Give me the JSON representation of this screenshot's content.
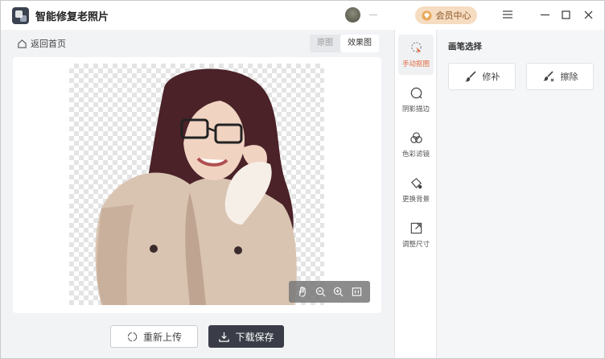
{
  "app": {
    "title": "智能修复老照片"
  },
  "header": {
    "vip_label": "会员中心",
    "user_name": "—"
  },
  "left": {
    "back_label": "返回首页",
    "view_toggle": {
      "original": "原图",
      "effect": "效果图",
      "selected": "效果图"
    },
    "upload_label": "重新上传",
    "save_label": "下载保存"
  },
  "tools": [
    {
      "label": "手动抠图",
      "icon": "cursor-cut-icon",
      "active": true
    },
    {
      "label": "阴影描边",
      "icon": "shadow-outline-icon",
      "active": false
    },
    {
      "label": "色彩滤镜",
      "icon": "color-filter-icon",
      "active": false
    },
    {
      "label": "更换背景",
      "icon": "paint-bucket-icon",
      "active": false
    },
    {
      "label": "调整尺寸",
      "icon": "resize-icon",
      "active": false
    }
  ],
  "brush": {
    "title": "画笔选择",
    "repair_label": "修补",
    "erase_label": "擦除"
  },
  "colors": {
    "accent": "#e0683b",
    "vip_bg": "#f6dcc0",
    "save_bg": "#3a3d47"
  }
}
